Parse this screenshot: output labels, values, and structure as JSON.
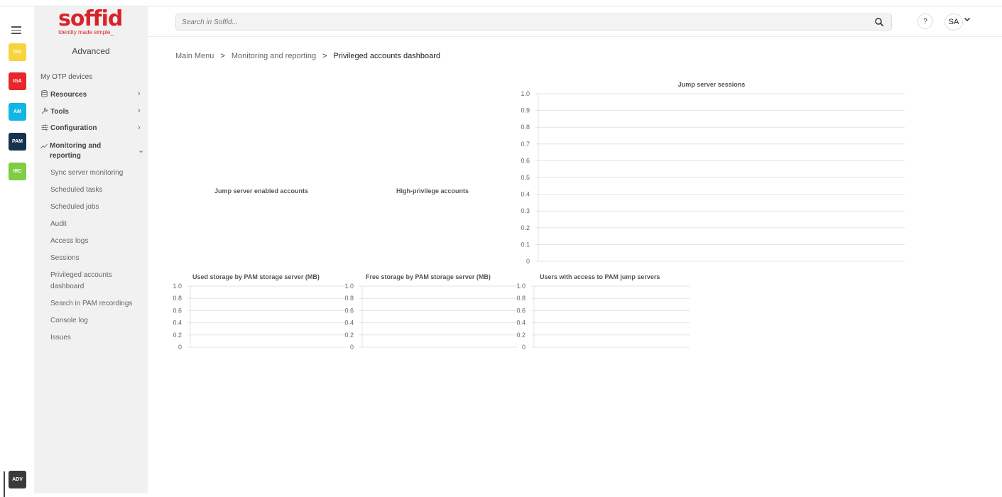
{
  "rail": {
    "apps": [
      {
        "label": "ISS",
        "color": "#f7d43b",
        "active": false
      },
      {
        "label": "IGA",
        "color": "#e8272c",
        "active": false
      },
      {
        "label": "AM",
        "color": "#12b5e3",
        "active": false
      },
      {
        "label": "PAM",
        "color": "#16324f",
        "active": true
      },
      {
        "label": "IRC",
        "color": "#7fcd43",
        "active": false
      }
    ],
    "bottom_app": {
      "label": "ADV",
      "color": "#3a3a3a"
    }
  },
  "logo": {
    "word": "soffid",
    "tagline": "Identity made simple_"
  },
  "nav": {
    "title": "Advanced",
    "items": [
      {
        "label": "My OTP devices"
      },
      {
        "label": "Resources",
        "icon": "database-icon"
      },
      {
        "label": "Tools",
        "icon": "wrench-icon"
      },
      {
        "label": "Configuration",
        "icon": "sliders-icon"
      },
      {
        "label": "Monitoring and reporting",
        "icon": "chart-line-icon"
      }
    ],
    "subitems": [
      "Sync server monitoring",
      "Scheduled tasks",
      "Scheduled jobs",
      "Audit",
      "Access logs",
      "Sessions",
      "Privileged accounts dashboard",
      "Search in PAM recordings",
      "Console log",
      "Issues"
    ]
  },
  "header": {
    "search_placeholder": "Search in Soffid...",
    "help_label": "?",
    "user_initials": "SA"
  },
  "breadcrumb": {
    "items": [
      "Main Menu",
      "Monitoring and reporting"
    ],
    "current": "Privileged accounts dashboard",
    "separator": ">"
  },
  "chart_data": [
    {
      "type": "pie",
      "title": "Jump server enabled accounts",
      "values": []
    },
    {
      "type": "pie",
      "title": "High-privilege accounts",
      "values": []
    },
    {
      "type": "bar",
      "title": "Jump server sessions",
      "categories": [],
      "values": [],
      "ylim": [
        0,
        1.0
      ],
      "yticks": [
        "1.0",
        "0.9",
        "0.8",
        "0.7",
        "0.6",
        "0.5",
        "0.4",
        "0.3",
        "0.2",
        "0.1",
        "0"
      ],
      "grid": true
    },
    {
      "type": "bar",
      "title": "Used storage by PAM storage server (MB)",
      "categories": [],
      "values": [],
      "ylim": [
        0,
        1.0
      ],
      "yticks": [
        "1.0",
        "0.8",
        "0.6",
        "0.4",
        "0.2",
        "0"
      ],
      "grid": true
    },
    {
      "type": "bar",
      "title": "Free storage by PAM storage server (MB)",
      "categories": [],
      "values": [],
      "ylim": [
        0,
        1.0
      ],
      "yticks": [
        "1.0",
        "0.8",
        "0.6",
        "0.4",
        "0.2",
        "0"
      ],
      "grid": true
    },
    {
      "type": "bar",
      "title": "Users with access to PAM jump servers",
      "categories": [],
      "values": [],
      "ylim": [
        0,
        1.0
      ],
      "yticks": [
        "1.0",
        "0.8",
        "0.6",
        "0.4",
        "0.2",
        "0"
      ],
      "grid": true
    }
  ]
}
